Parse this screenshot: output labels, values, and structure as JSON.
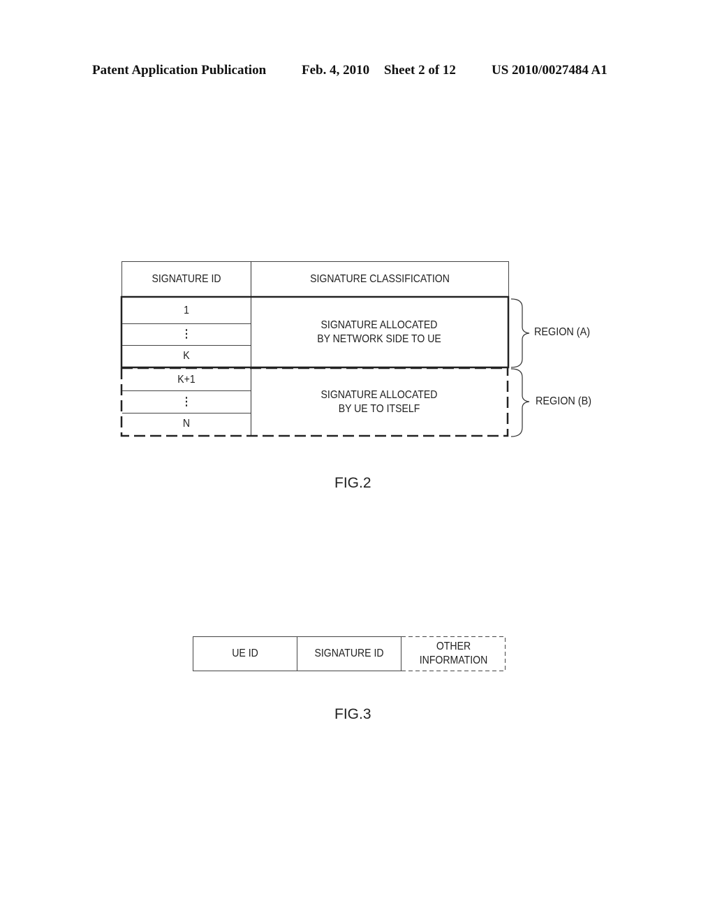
{
  "header": {
    "left": "Patent Application Publication",
    "date": "Feb. 4, 2010",
    "sheet": "Sheet 2 of 12",
    "number": "US 2010/0027484 A1"
  },
  "fig2": {
    "columns": [
      "SIGNATURE ID",
      "SIGNATURE CLASSIFICATION"
    ],
    "region_a": {
      "ids": [
        "1",
        "⋮",
        "K"
      ],
      "classification_line1": "SIGNATURE ALLOCATED",
      "classification_line2": "BY NETWORK SIDE TO UE",
      "label": "REGION (A)"
    },
    "region_b": {
      "ids": [
        "K+1",
        "⋮",
        "N"
      ],
      "classification_line1": "SIGNATURE ALLOCATED",
      "classification_line2": "BY UE TO ITSELF",
      "label": "REGION (B)"
    },
    "caption": "FIG.2"
  },
  "fig3": {
    "fields": [
      "UE ID",
      "SIGNATURE ID"
    ],
    "optional_field_line1": "OTHER",
    "optional_field_line2": "INFORMATION",
    "caption": "FIG.3"
  }
}
